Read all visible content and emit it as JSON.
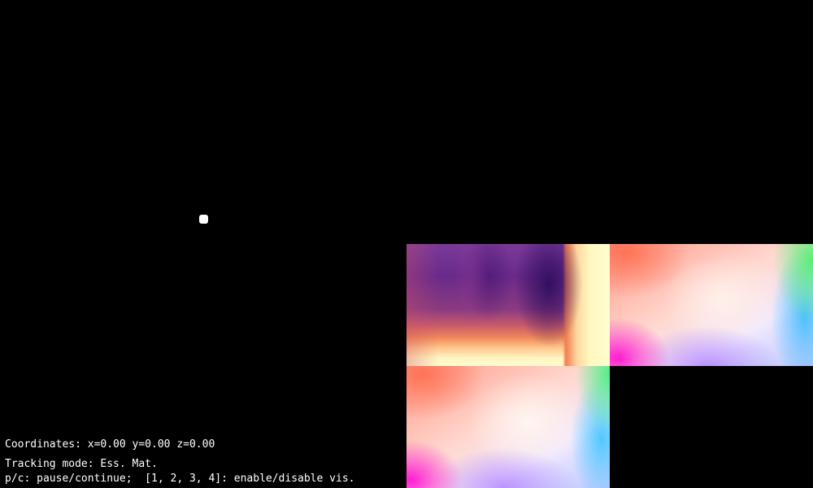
{
  "hud": {
    "coordinates": "Coordinates: x=0.00 y=0.00 z=0.00",
    "tracking_mode": "Tracking mode: Ess. Mat.",
    "help": "p/c: pause/continue;  [1, 2, 3, 4]: enable/disable vis."
  },
  "colors": {
    "background": "#000000",
    "text": "#ffffff",
    "trajectory_point": "#ffffff"
  }
}
